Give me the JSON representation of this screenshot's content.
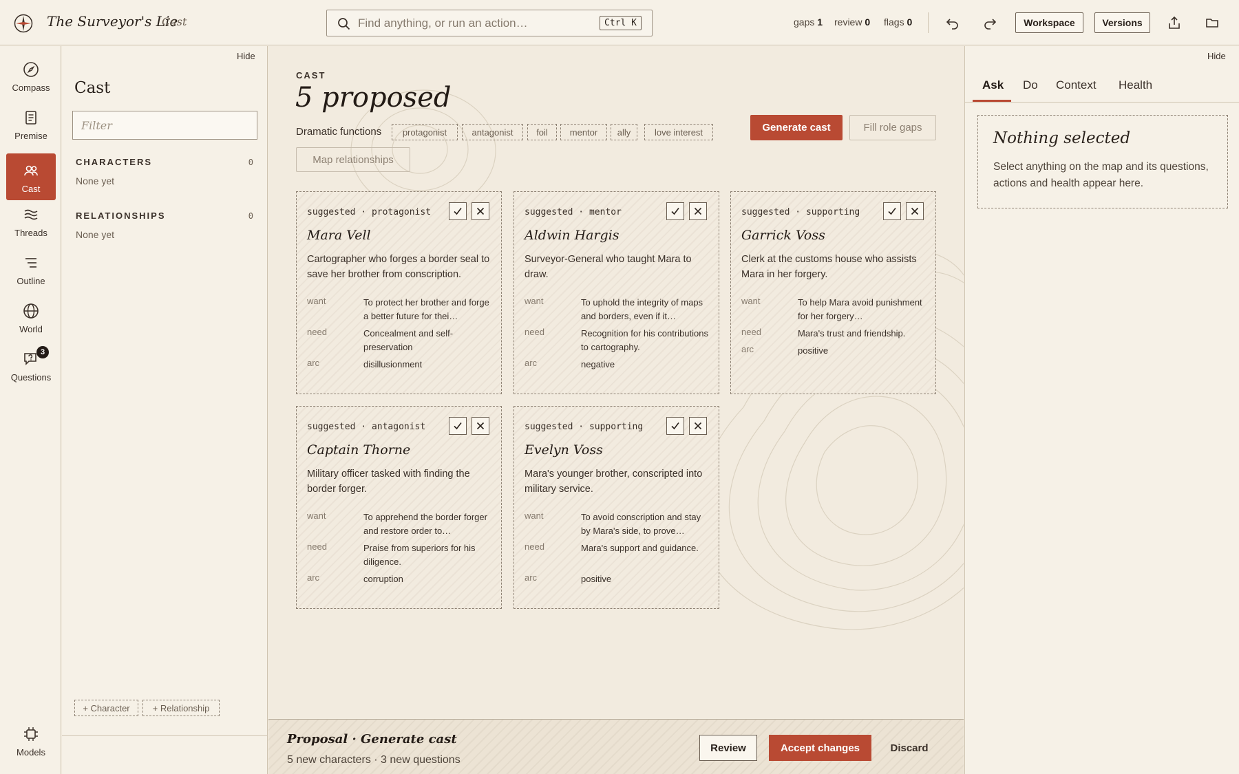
{
  "app": {
    "title": "The Surveyor's Lie",
    "section": "Cast"
  },
  "search": {
    "placeholder": "Find anything, or run an action…",
    "shortcut": "Ctrl K"
  },
  "stats": [
    {
      "label": "gaps",
      "value": "1"
    },
    {
      "label": "review",
      "value": "0"
    },
    {
      "label": "flags",
      "value": "0"
    }
  ],
  "toolbar": {
    "workspace_label": "Workspace",
    "versions_label": "Versions",
    "icons": [
      "undo-icon",
      "redo-icon",
      "export-icon",
      "folder-icon"
    ]
  },
  "rail": {
    "items": [
      {
        "label": "Compass",
        "icon": "compass-icon"
      },
      {
        "label": "Premise",
        "icon": "document-icon"
      },
      {
        "label": "Cast",
        "icon": "people-icon",
        "active": true
      },
      {
        "label": "Threads",
        "icon": "threads-icon"
      },
      {
        "label": "Outline",
        "icon": "outline-icon"
      },
      {
        "label": "World",
        "icon": "globe-icon"
      },
      {
        "label": "Questions",
        "icon": "question-bubble-icon",
        "badge": "3"
      }
    ],
    "bottom": {
      "label": "Models",
      "icon": "chip-icon"
    }
  },
  "cast_panel": {
    "hide": "Hide",
    "title": "Cast",
    "filter_placeholder": "Filter",
    "characters": {
      "heading": "CHARACTERS",
      "count": "0",
      "empty": "None yet"
    },
    "relationships": {
      "heading": "RELATIONSHIPS",
      "count": "0",
      "empty": "None yet"
    },
    "add_character": "+ Character",
    "add_relationship": "+ Relationship"
  },
  "main": {
    "eyebrow": "CAST",
    "title": "5 proposed",
    "dramatic_functions_label": "Dramatic functions",
    "functions": [
      "protagonist",
      "antagonist",
      "foil",
      "mentor",
      "ally",
      "love interest"
    ],
    "generate_label": "Generate cast",
    "fill_label": "Fill role gaps",
    "map_label": "Map relationships",
    "field_labels": {
      "want": "want",
      "need": "need",
      "arc": "arc"
    },
    "cards": [
      {
        "status": "suggested",
        "role": "protagonist",
        "name": "Mara Vell",
        "description": "Cartographer who forges a border seal to save her brother from conscription.",
        "want": "To protect her brother and forge a better future for thei…",
        "need": "Concealment and self-preservation",
        "arc": "disillusionment"
      },
      {
        "status": "suggested",
        "role": "mentor",
        "name": "Aldwin Hargis",
        "description": "Surveyor-General who taught Mara to draw.",
        "want": "To uphold the integrity of maps and borders, even if it…",
        "need": "Recognition for his contributions to cartography.",
        "arc": "negative"
      },
      {
        "status": "suggested",
        "role": "supporting",
        "name": "Garrick Voss",
        "description": "Clerk at the customs house who assists Mara in her forgery.",
        "want": "To help Mara avoid punishment for her forgery…",
        "need": "Mara's trust and friendship.",
        "arc": "positive"
      },
      {
        "status": "suggested",
        "role": "antagonist",
        "name": "Captain Thorne",
        "description": "Military officer tasked with finding the border forger.",
        "want": "To apprehend the border forger and restore order to…",
        "need": "Praise from superiors for his diligence.",
        "arc": "corruption"
      },
      {
        "status": "suggested",
        "role": "supporting",
        "name": "Evelyn Voss",
        "description": "Mara's younger brother, conscripted into military service.",
        "want": "To avoid conscription and stay by Mara's side, to prove…",
        "need": "Mara's support and guidance.",
        "arc": "positive"
      }
    ]
  },
  "proposal": {
    "title": "Proposal · Generate cast",
    "summary": "5 new characters · 3 new questions",
    "review_label": "Review",
    "accept_label": "Accept changes",
    "discard_label": "Discard"
  },
  "right_panel": {
    "hide": "Hide",
    "tabs": [
      "Ask",
      "Do",
      "Context",
      "Health"
    ],
    "active_tab": "Ask",
    "empty_title": "Nothing selected",
    "empty_desc": "Select anything on the map and its questions, actions and health appear here."
  },
  "colors": {
    "accent": "#b94a33",
    "background": "#f3ede1",
    "ink": "#2a221c"
  }
}
